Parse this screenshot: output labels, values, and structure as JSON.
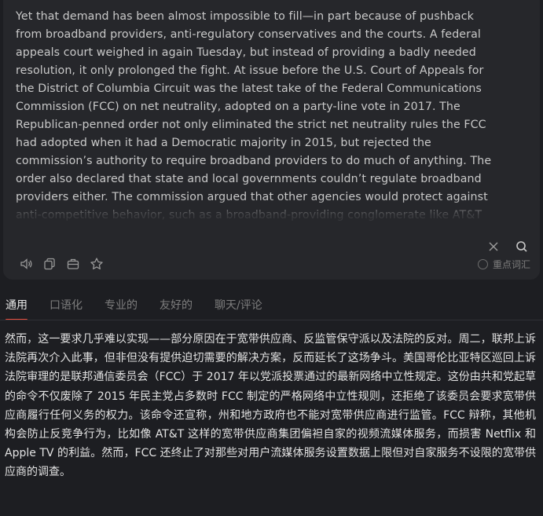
{
  "source": {
    "text": "Yet that demand has been almost impossible to fill—in part because of pushback from broadband providers, anti-regulatory conservatives and the courts. A federal appeals court weighed in again Tuesday, but instead of providing a badly needed resolution, it only prolonged the fight. At issue before the U.S. Court of Appeals for the District of Columbia Circuit was the latest take of the Federal Communications Commission (FCC) on net neutrality, adopted on a party-line vote in 2017. The Republican-penned order not only eliminated the strict net neutrality rules the FCC had adopted when it had a Democratic majority in 2015, but rejected the commission’s authority to require broadband providers to do much of anything. The order also declared that state and local governments couldn’t regulate broadband providers either. The commission argued that other agencies would protect against anti-competitive behavior, such as a broadband-providing conglomerate like AT&T favoring its own"
  },
  "tools": {
    "close_icon": "close-icon",
    "search_icon": "search-icon"
  },
  "actions": [
    {
      "name": "speaker-icon"
    },
    {
      "name": "copy-icon"
    },
    {
      "name": "briefcase-icon"
    },
    {
      "name": "star-icon"
    }
  ],
  "keyword_toggle": {
    "label": "重点词汇"
  },
  "tabs": [
    {
      "label": "通用",
      "active": true
    },
    {
      "label": "口语化",
      "active": false
    },
    {
      "label": "专业的",
      "active": false
    },
    {
      "label": "友好的",
      "active": false
    },
    {
      "label": "聊天/评论",
      "active": false
    }
  ],
  "translation": {
    "text": "然而，这一要求几乎难以实现——部分原因在于宽带供应商、反监管保守派以及法院的反对。周二，联邦上诉法院再次介入此事，但非但没有提供迫切需要的解决方案，反而延长了这场争斗。美国哥伦比亚特区巡回上诉法院审理的是联邦通信委员会（FCC）于 2017 年以党派投票通过的最新网络中立性规定。这份由共和党起草的命令不仅废除了 2015 年民主党占多数时 FCC 制定的严格网络中立性规则，还拒绝了该委员会要求宽带供应商履行任何义务的权力。该命令还宣称，州和地方政府也不能对宽带供应商进行监管。FCC 辩称，其他机构会防止反竞争行为，比如像 AT&T 这样的宽带供应商集团偏袒自家的视频流媒体服务，而损害 Netflix 和 Apple TV 的利益。然而，FCC 还终止了对那些对用户流媒体服务设置数据上限但对自家服务不设限的宽带供应商的调查。"
  },
  "colors": {
    "background": "#1d1e22",
    "card": "#26272b",
    "active_tab_underline": "#e84d3d"
  }
}
